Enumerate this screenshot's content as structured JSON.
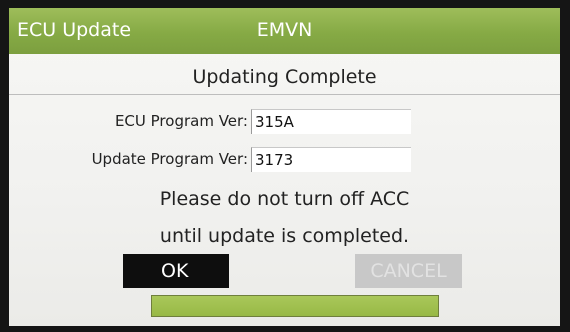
{
  "header": {
    "app_title": "ECU Update",
    "mode_title": "EMVN"
  },
  "status": {
    "title": "Updating Complete"
  },
  "fields": {
    "ecu_program_label": "ECU Program Ver:",
    "ecu_program_value": "315A",
    "update_program_label": "Update Program Ver:",
    "update_program_value": "3173"
  },
  "message": {
    "line1": "Please do not turn off ACC",
    "line2": "until update is completed."
  },
  "buttons": {
    "ok_label": "OK",
    "cancel_label": "CANCEL"
  },
  "progress": {
    "fraction": 1.0
  },
  "colors": {
    "header_green": "#86aa45",
    "progress_green": "#a2c250",
    "ok_button": "#0e0e0e",
    "cancel_button_disabled": "#c8c8c8"
  }
}
